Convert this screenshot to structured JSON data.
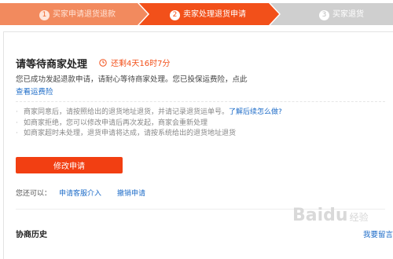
{
  "steps": [
    {
      "num": "1",
      "label": "买家申请退货退款",
      "state": "done"
    },
    {
      "num": "2",
      "label": "卖家处理退货申请",
      "state": "active"
    },
    {
      "num": "3",
      "label": "买家退货",
      "state": "pending"
    }
  ],
  "colors": {
    "accent": "#f23f12",
    "done_step": "#f28a5e",
    "active_step": "#f2501a",
    "pending_step": "#cfcfcf",
    "link": "#1e6cc8"
  },
  "status": {
    "title": "请等待商家处理",
    "timer": "还剩4天16时7分",
    "desc": "您已成功发起退款申请，请耐心等待商家处理。您已投保运费险，点此",
    "desc_link": "查看运费险"
  },
  "tips": {
    "tip1_text": "商家同意后，请按照给出的退货地址退货，并请记录退货运单号。",
    "tip1_link": "了解后续怎么做?",
    "tip2_text": "如商家拒绝，您可以修改申请后再次发起，商家会重新处理",
    "tip3_text": "如商家超时未处理，退货申请将达成，请按系统给出的退货地址退货"
  },
  "actions": {
    "modify_button": "修改申请",
    "also_label": "您还可以：",
    "request_service": "申请客服介入",
    "cancel_request": "撤销申请"
  },
  "history": {
    "title": "协商历史",
    "leave_message": "我要留言"
  },
  "watermark": {
    "brand": "Baidu",
    "sub": "经验"
  }
}
